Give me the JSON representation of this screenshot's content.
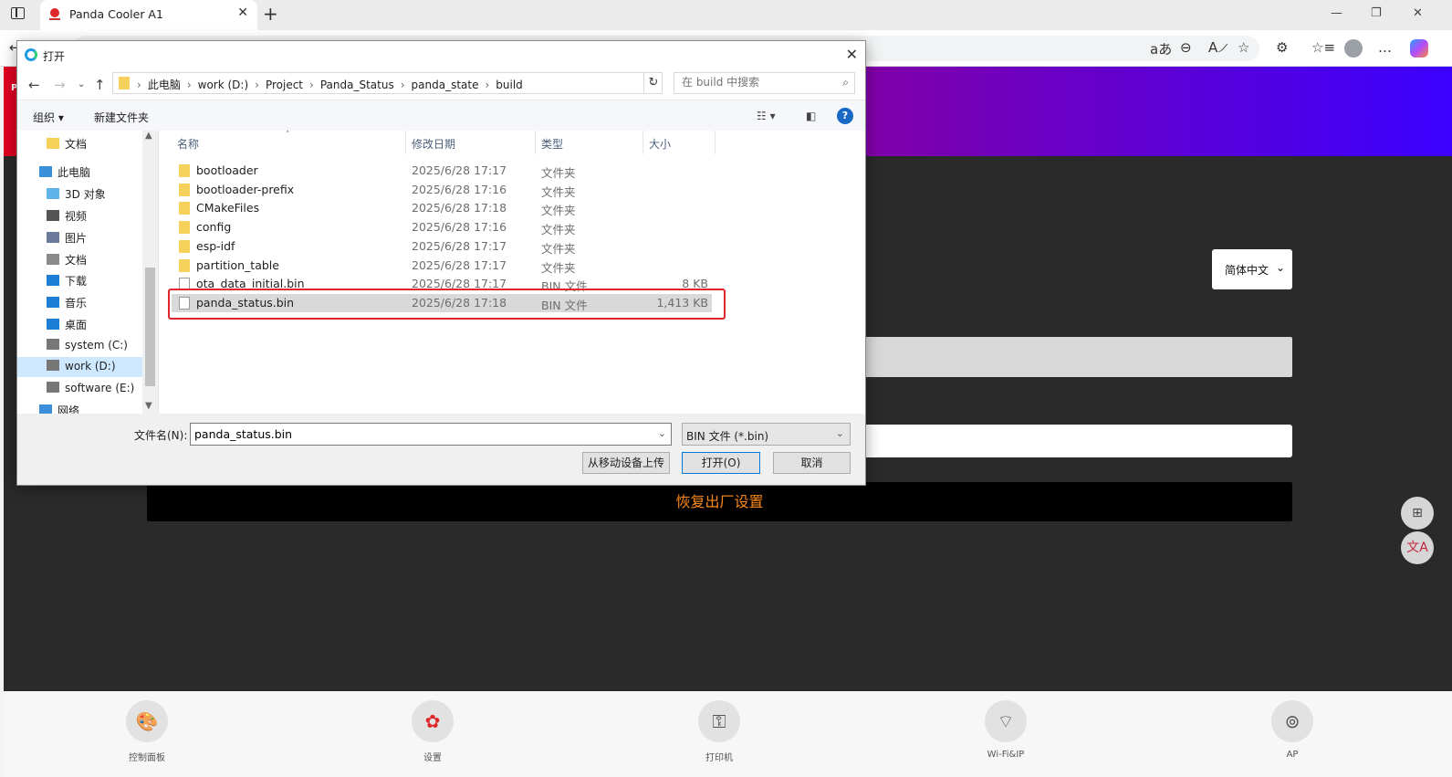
{
  "browser": {
    "tab_title": "Panda Cooler A1",
    "tab_close": "✕",
    "new_tab": "+",
    "window_controls": [
      "—",
      "❐",
      "✕"
    ],
    "toolbar_icons": [
      "aあ",
      "⊖",
      "A୵",
      "☆",
      "⚙",
      "☆≡",
      "…"
    ]
  },
  "page": {
    "hero_logo": "P",
    "language_select": "简体中文",
    "reset_button": "恢复出厂设置",
    "float_buttons": [
      "⊞",
      "文A"
    ],
    "nav": [
      {
        "label": "控制面板",
        "icon": "palette-icon",
        "glyph": "🎨"
      },
      {
        "label": "设置",
        "icon": "gear-icon",
        "glyph": "✿"
      },
      {
        "label": "打印机",
        "icon": "sitemap-icon",
        "glyph": "⚿"
      },
      {
        "label": "Wi-Fi&IP",
        "icon": "wifi-icon",
        "glyph": "⌔"
      },
      {
        "label": "AP",
        "icon": "antenna-icon",
        "glyph": "⊚"
      }
    ]
  },
  "dialog": {
    "title": "打开",
    "breadcrumb": [
      "此电脑",
      "work (D:)",
      "Project",
      "Panda_Status",
      "panda_state",
      "build"
    ],
    "search_placeholder": "在 build 中搜索",
    "toolbar": {
      "organize": "组织 ▾",
      "new_folder": "新建文件夹"
    },
    "help": "?",
    "nav_tree": [
      {
        "label": "文档",
        "icon": "folder-icon"
      },
      {
        "label": "此电脑",
        "icon": "computer-icon"
      },
      {
        "label": "3D 对象",
        "icon": "cube-icon"
      },
      {
        "label": "视频",
        "icon": "video-icon"
      },
      {
        "label": "图片",
        "icon": "picture-icon"
      },
      {
        "label": "文档",
        "icon": "document-icon"
      },
      {
        "label": "下载",
        "icon": "download-icon"
      },
      {
        "label": "音乐",
        "icon": "music-icon"
      },
      {
        "label": "桌面",
        "icon": "desktop-icon"
      },
      {
        "label": "system (C:)",
        "icon": "drive-icon"
      },
      {
        "label": "work (D:)",
        "icon": "drive-icon",
        "selected": true
      },
      {
        "label": "software (E:)",
        "icon": "drive-icon"
      },
      {
        "label": "网络",
        "icon": "network-icon"
      }
    ],
    "columns": [
      "名称",
      "修改日期",
      "类型",
      "大小"
    ],
    "files": [
      {
        "name": "bootloader",
        "date": "2025/6/28 17:17",
        "type": "文件夹",
        "size": "",
        "kind": "folder"
      },
      {
        "name": "bootloader-prefix",
        "date": "2025/6/28 17:16",
        "type": "文件夹",
        "size": "",
        "kind": "folder"
      },
      {
        "name": "CMakeFiles",
        "date": "2025/6/28 17:18",
        "type": "文件夹",
        "size": "",
        "kind": "folder"
      },
      {
        "name": "config",
        "date": "2025/6/28 17:16",
        "type": "文件夹",
        "size": "",
        "kind": "folder"
      },
      {
        "name": "esp-idf",
        "date": "2025/6/28 17:17",
        "type": "文件夹",
        "size": "",
        "kind": "folder"
      },
      {
        "name": "partition_table",
        "date": "2025/6/28 17:17",
        "type": "文件夹",
        "size": "",
        "kind": "folder"
      },
      {
        "name": "ota_data_initial.bin",
        "date": "2025/6/28 17:17",
        "type": "BIN 文件",
        "size": "8 KB",
        "kind": "file"
      },
      {
        "name": "panda_status.bin",
        "date": "2025/6/28 17:18",
        "type": "BIN 文件",
        "size": "1,413 KB",
        "kind": "file",
        "selected": true
      }
    ],
    "filename_label": "文件名(N):",
    "filename_value": "panda_status.bin",
    "filter": "BIN 文件 (*.bin)",
    "buttons": {
      "upload": "从移动设备上传",
      "open": "打开(O)",
      "cancel": "取消"
    }
  }
}
